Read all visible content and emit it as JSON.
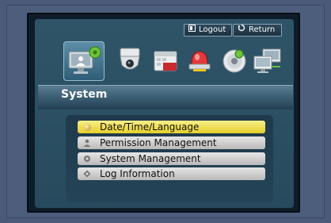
{
  "top_buttons": {
    "logout_label": "Logout",
    "return_label": "Return"
  },
  "icons": [
    {
      "name": "system-setup-icon",
      "selected": true
    },
    {
      "name": "camera-icon",
      "selected": false
    },
    {
      "name": "record-icon",
      "selected": false
    },
    {
      "name": "alarm-icon",
      "selected": false
    },
    {
      "name": "disk-icon",
      "selected": false
    },
    {
      "name": "network-icon",
      "selected": false
    }
  ],
  "section_title": "System",
  "menu": [
    {
      "label": "Date/Time/Language",
      "active": true
    },
    {
      "label": "Permission Management",
      "active": false
    },
    {
      "label": "System Management",
      "active": false
    },
    {
      "label": "Log Information",
      "active": false
    }
  ],
  "colors": {
    "highlight": "#eed840",
    "panel": "#2c5064"
  }
}
